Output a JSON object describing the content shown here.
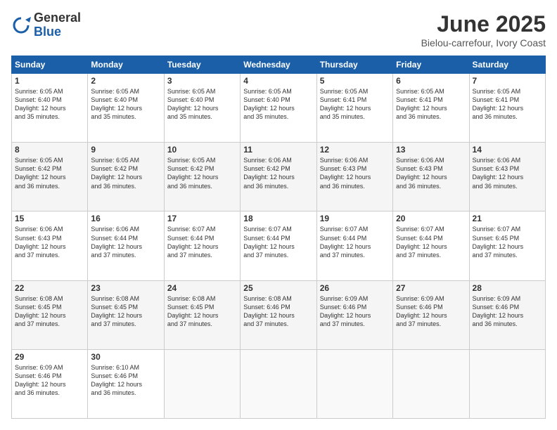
{
  "header": {
    "logo_general": "General",
    "logo_blue": "Blue",
    "month_title": "June 2025",
    "location": "Bielou-carrefour, Ivory Coast"
  },
  "days_of_week": [
    "Sunday",
    "Monday",
    "Tuesday",
    "Wednesday",
    "Thursday",
    "Friday",
    "Saturday"
  ],
  "weeks": [
    [
      {
        "day": "1",
        "info": "Sunrise: 6:05 AM\nSunset: 6:40 PM\nDaylight: 12 hours\nand 35 minutes."
      },
      {
        "day": "2",
        "info": "Sunrise: 6:05 AM\nSunset: 6:40 PM\nDaylight: 12 hours\nand 35 minutes."
      },
      {
        "day": "3",
        "info": "Sunrise: 6:05 AM\nSunset: 6:40 PM\nDaylight: 12 hours\nand 35 minutes."
      },
      {
        "day": "4",
        "info": "Sunrise: 6:05 AM\nSunset: 6:40 PM\nDaylight: 12 hours\nand 35 minutes."
      },
      {
        "day": "5",
        "info": "Sunrise: 6:05 AM\nSunset: 6:41 PM\nDaylight: 12 hours\nand 35 minutes."
      },
      {
        "day": "6",
        "info": "Sunrise: 6:05 AM\nSunset: 6:41 PM\nDaylight: 12 hours\nand 36 minutes."
      },
      {
        "day": "7",
        "info": "Sunrise: 6:05 AM\nSunset: 6:41 PM\nDaylight: 12 hours\nand 36 minutes."
      }
    ],
    [
      {
        "day": "8",
        "info": "Sunrise: 6:05 AM\nSunset: 6:42 PM\nDaylight: 12 hours\nand 36 minutes."
      },
      {
        "day": "9",
        "info": "Sunrise: 6:05 AM\nSunset: 6:42 PM\nDaylight: 12 hours\nand 36 minutes."
      },
      {
        "day": "10",
        "info": "Sunrise: 6:05 AM\nSunset: 6:42 PM\nDaylight: 12 hours\nand 36 minutes."
      },
      {
        "day": "11",
        "info": "Sunrise: 6:06 AM\nSunset: 6:42 PM\nDaylight: 12 hours\nand 36 minutes."
      },
      {
        "day": "12",
        "info": "Sunrise: 6:06 AM\nSunset: 6:43 PM\nDaylight: 12 hours\nand 36 minutes."
      },
      {
        "day": "13",
        "info": "Sunrise: 6:06 AM\nSunset: 6:43 PM\nDaylight: 12 hours\nand 36 minutes."
      },
      {
        "day": "14",
        "info": "Sunrise: 6:06 AM\nSunset: 6:43 PM\nDaylight: 12 hours\nand 36 minutes."
      }
    ],
    [
      {
        "day": "15",
        "info": "Sunrise: 6:06 AM\nSunset: 6:43 PM\nDaylight: 12 hours\nand 37 minutes."
      },
      {
        "day": "16",
        "info": "Sunrise: 6:06 AM\nSunset: 6:44 PM\nDaylight: 12 hours\nand 37 minutes."
      },
      {
        "day": "17",
        "info": "Sunrise: 6:07 AM\nSunset: 6:44 PM\nDaylight: 12 hours\nand 37 minutes."
      },
      {
        "day": "18",
        "info": "Sunrise: 6:07 AM\nSunset: 6:44 PM\nDaylight: 12 hours\nand 37 minutes."
      },
      {
        "day": "19",
        "info": "Sunrise: 6:07 AM\nSunset: 6:44 PM\nDaylight: 12 hours\nand 37 minutes."
      },
      {
        "day": "20",
        "info": "Sunrise: 6:07 AM\nSunset: 6:44 PM\nDaylight: 12 hours\nand 37 minutes."
      },
      {
        "day": "21",
        "info": "Sunrise: 6:07 AM\nSunset: 6:45 PM\nDaylight: 12 hours\nand 37 minutes."
      }
    ],
    [
      {
        "day": "22",
        "info": "Sunrise: 6:08 AM\nSunset: 6:45 PM\nDaylight: 12 hours\nand 37 minutes."
      },
      {
        "day": "23",
        "info": "Sunrise: 6:08 AM\nSunset: 6:45 PM\nDaylight: 12 hours\nand 37 minutes."
      },
      {
        "day": "24",
        "info": "Sunrise: 6:08 AM\nSunset: 6:45 PM\nDaylight: 12 hours\nand 37 minutes."
      },
      {
        "day": "25",
        "info": "Sunrise: 6:08 AM\nSunset: 6:46 PM\nDaylight: 12 hours\nand 37 minutes."
      },
      {
        "day": "26",
        "info": "Sunrise: 6:09 AM\nSunset: 6:46 PM\nDaylight: 12 hours\nand 37 minutes."
      },
      {
        "day": "27",
        "info": "Sunrise: 6:09 AM\nSunset: 6:46 PM\nDaylight: 12 hours\nand 37 minutes."
      },
      {
        "day": "28",
        "info": "Sunrise: 6:09 AM\nSunset: 6:46 PM\nDaylight: 12 hours\nand 36 minutes."
      }
    ],
    [
      {
        "day": "29",
        "info": "Sunrise: 6:09 AM\nSunset: 6:46 PM\nDaylight: 12 hours\nand 36 minutes."
      },
      {
        "day": "30",
        "info": "Sunrise: 6:10 AM\nSunset: 6:46 PM\nDaylight: 12 hours\nand 36 minutes."
      },
      null,
      null,
      null,
      null,
      null
    ]
  ]
}
